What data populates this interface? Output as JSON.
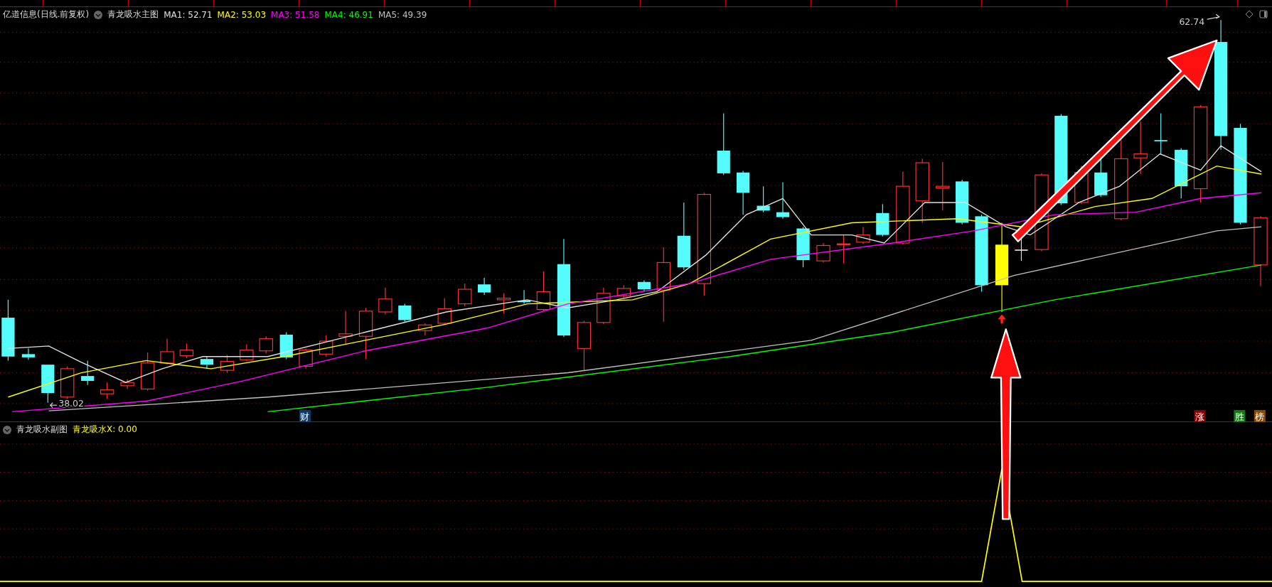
{
  "main_chart": {
    "stock_title": "亿道信息(日线.前复权)",
    "indicator_name": "青龙吸水主图",
    "moving_averages": [
      {
        "label": "MA1: 52.71",
        "color": "#e0e0e0"
      },
      {
        "label": "MA2: 53.03",
        "color": "#ffff00"
      },
      {
        "label": "MA3: 51.58",
        "color": "#ff00ff"
      },
      {
        "label": "MA4: 46.91",
        "color": "#00ff00"
      },
      {
        "label": "MA5: 49.39",
        "color": "#c0c0c0"
      }
    ],
    "high_label": "62.74",
    "low_label": "38.02",
    "markers": [
      {
        "text": "财",
        "color": "#0b3a6b"
      },
      {
        "text": "涨",
        "color": "#8b0000"
      },
      {
        "text": "胜",
        "color": "#107a10"
      },
      {
        "text": "榜",
        "color": "#8b4a00"
      }
    ]
  },
  "sub_chart": {
    "indicator_name": "青龙吸水副图",
    "value_label": "青龙吸水X: 0.00"
  }
}
